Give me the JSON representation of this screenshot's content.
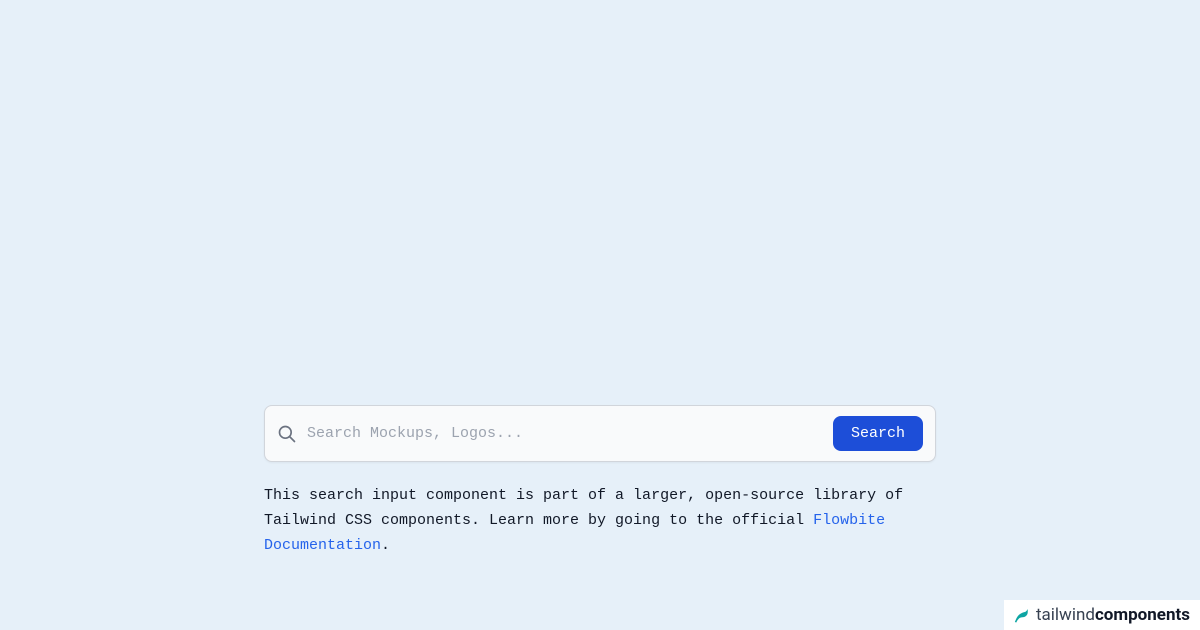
{
  "search": {
    "placeholder": "Search Mockups, Logos...",
    "button_label": "Search",
    "value": ""
  },
  "description": {
    "text_before_link": "This search input component is part of a larger, open-source library of Tailwind CSS components. Learn more by going to the official ",
    "link_text": "Flowbite Documentation",
    "text_after_link": "."
  },
  "footer": {
    "brand_light": "tailwind",
    "brand_bold": "components"
  }
}
